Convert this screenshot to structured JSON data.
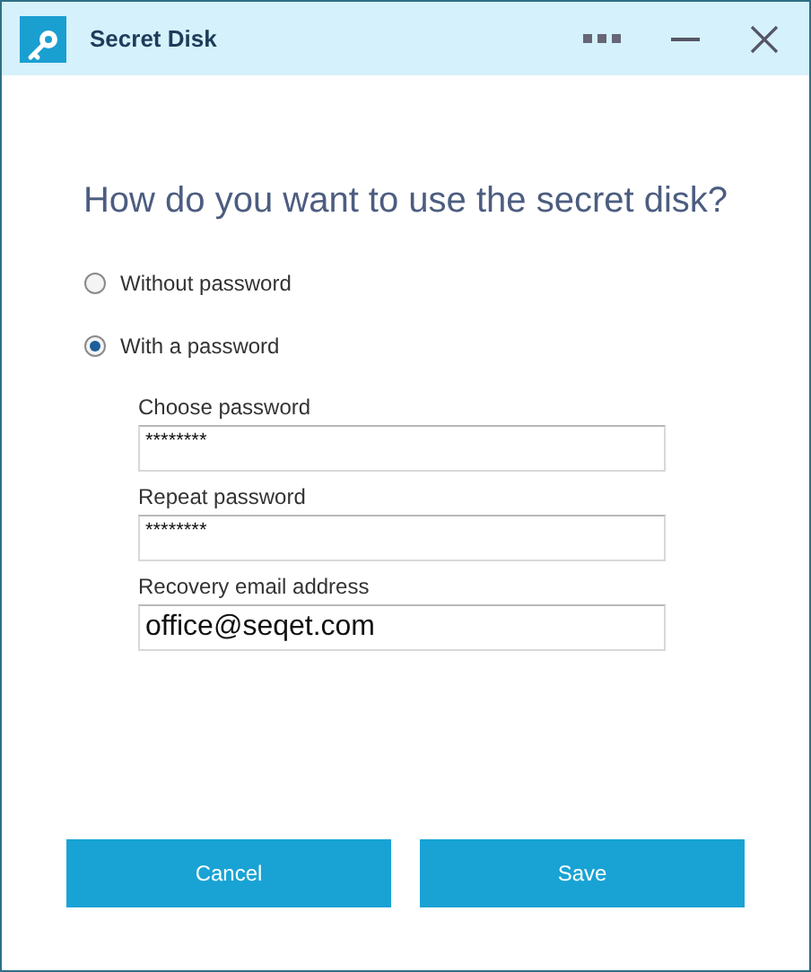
{
  "window": {
    "title": "Secret Disk"
  },
  "heading": "How do you want to use the secret disk?",
  "options": [
    {
      "label": "Without password",
      "selected": false
    },
    {
      "label": "With a password",
      "selected": true
    }
  ],
  "fields": [
    {
      "label": "Choose password",
      "value": "********",
      "kind": "secret"
    },
    {
      "label": "Repeat password",
      "value": "********",
      "kind": "secret"
    },
    {
      "label": "Recovery email address",
      "value": "office@seqet.com",
      "kind": "text"
    }
  ],
  "buttons": [
    "Cancel",
    "Save"
  ]
}
